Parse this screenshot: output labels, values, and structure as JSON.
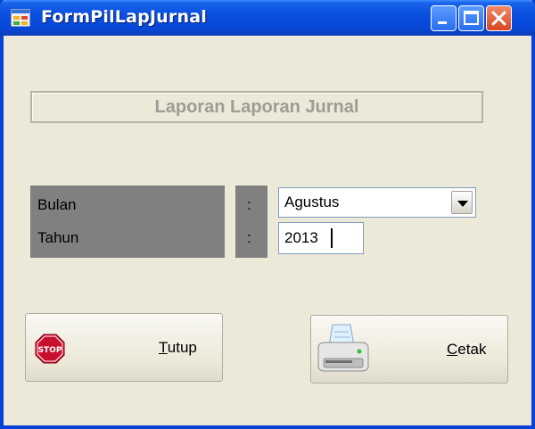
{
  "window": {
    "title": "FormPilLapJurnal",
    "icons": {
      "app": "form-app-icon",
      "minimize": "minimize-icon",
      "maximize": "maximize-icon",
      "close": "close-icon"
    }
  },
  "header": {
    "title": "Laporan Laporan Jurnal"
  },
  "form": {
    "bulan_label": "Bulan",
    "tahun_label": "Tahun",
    "colon": ":",
    "bulan_value": "Agustus",
    "tahun_value": "2013"
  },
  "buttons": {
    "tutup": {
      "mnemonic": "T",
      "rest": "utup",
      "icon": "stop-icon"
    },
    "cetak": {
      "mnemonic": "C",
      "rest": "etak",
      "icon": "printer-icon"
    }
  },
  "colors": {
    "titlebar": "#0a4fe0",
    "window_bg": "#ece9d8",
    "label_panel": "#808080",
    "group_text": "#9d9c96"
  }
}
